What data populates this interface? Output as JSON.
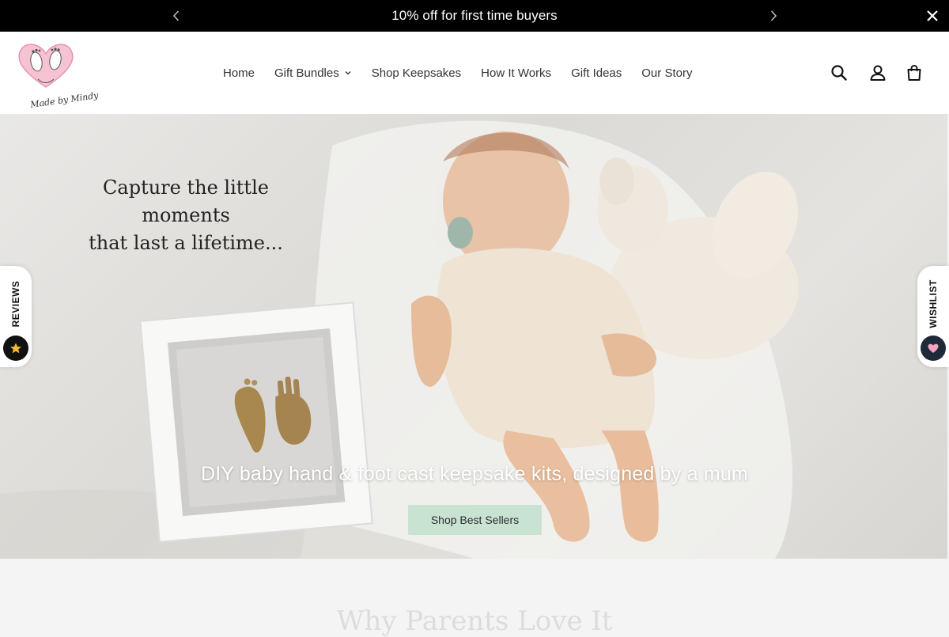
{
  "announcement": {
    "text": "10% off for first time buyers"
  },
  "header": {
    "logo_alt": "Made by Mindy",
    "nav": [
      {
        "label": "Home"
      },
      {
        "label": "Gift Bundles"
      },
      {
        "label": "Shop Keepsakes"
      },
      {
        "label": "How It Works"
      },
      {
        "label": "Gift Ideas"
      },
      {
        "label": "Our Story"
      }
    ]
  },
  "hero": {
    "tagline_line1": "Capture the little moments",
    "tagline_line2": "that last a lifetime...",
    "subtitle": "DIY baby hand & foot cast keepsake kits, designed by a mum",
    "cta_label": "Shop Best Sellers"
  },
  "side_tabs": {
    "reviews_label": "REVIEWS",
    "wishlist_label": "WISHLIST"
  },
  "next_section": {
    "title": "Why Parents Love It"
  },
  "colors": {
    "announcement_bg": "#000000",
    "cta_bg": "#c9e3d3",
    "logo_pink": "#f0a9c0",
    "heart_pink": "#f4a3c0",
    "star_yellow": "#f5b82e"
  }
}
